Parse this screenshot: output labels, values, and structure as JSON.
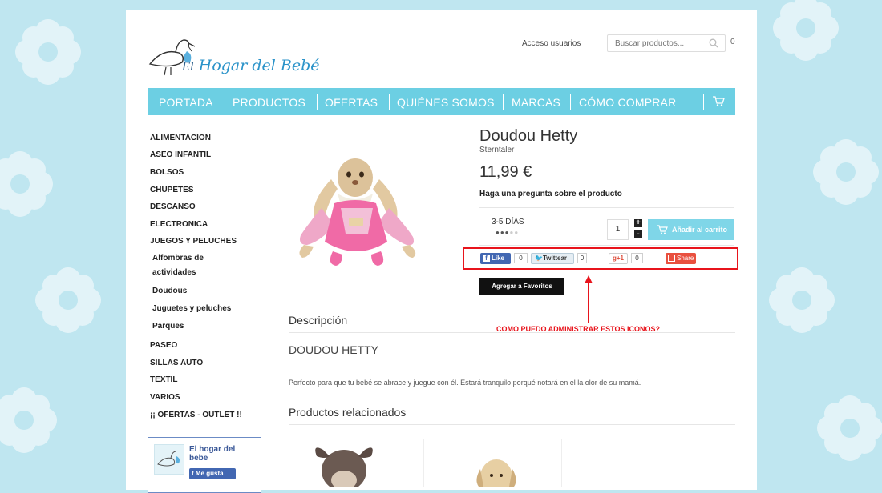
{
  "header": {
    "logo_text_el": "El",
    "logo_text_main": "Hogar del Bebé",
    "login_link": "Acceso usuarios",
    "search_placeholder": "Buscar productos...",
    "cart_count": "0"
  },
  "nav": {
    "items": [
      "PORTADA",
      "PRODUCTOS",
      "OFERTAS",
      "QUIÉNES SOMOS",
      "MARCAS",
      "CÓMO COMPRAR"
    ]
  },
  "sidebar": {
    "categories": [
      "ALIMENTACION",
      "ASEO INFANTIL",
      "BOLSOS",
      "CHUPETES",
      "DESCANSO",
      "ELECTRONICA",
      "JUEGOS Y PELUCHES"
    ],
    "subcategories": [
      "Alfombras de actividades",
      "Doudous",
      "Juguetes y peluches",
      "Parques"
    ],
    "categories_after": [
      "PASEO",
      "SILLAS AUTO",
      "TEXTIL",
      "VARIOS",
      "¡¡ OFERTAS - OUTLET !!"
    ],
    "fb_page_name": "El hogar del bebe",
    "fb_like_label": "Me gusta"
  },
  "product": {
    "title": "Doudou Hetty",
    "brand": "Sterntaler",
    "price": "11,99 €",
    "ask_question": "Haga una pregunta sobre el producto",
    "delivery": "3-5 DÍAS",
    "delivery_level": 3,
    "delivery_level_max": 6,
    "quantity": "1",
    "qty_plus": "+",
    "qty_minus": "-",
    "add_to_cart": "Añadir al carrito",
    "add_favorites": "Agregar a Favoritos"
  },
  "social": {
    "fb_like": "Like",
    "fb_count": "0",
    "twitter": "Twittear",
    "twitter_count": "0",
    "gplus": "+1",
    "gplus_count": "0",
    "share": "Share"
  },
  "annotation": "COMO PUEDO ADMINISTRAR ESTOS ICONOS?",
  "description": {
    "section_title": "Descripción",
    "heading": "DOUDOU HETTY",
    "text": "Perfecto para que tu bebé se abrace y juegue con él. Estará tranquilo porqué notará en el la olor de su mamá."
  },
  "related": {
    "section_title": "Productos relacionados"
  },
  "colors": {
    "background": "#bfe6f0",
    "nav": "#6ccfe3",
    "add_cart": "#7fd6e8",
    "annotation": "#e8141c",
    "facebook": "#4267b2"
  }
}
